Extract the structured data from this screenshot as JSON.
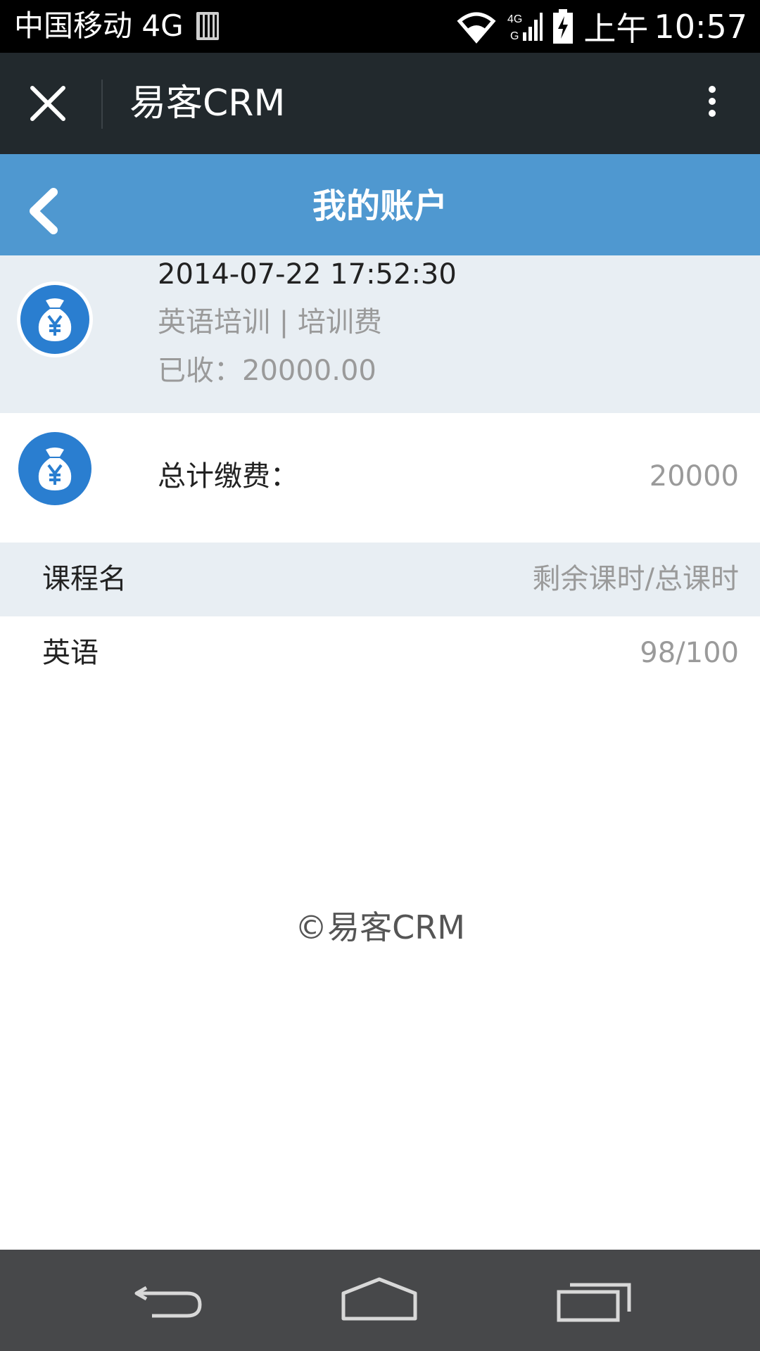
{
  "status_bar": {
    "carrier": "中国移动 4G",
    "time_prefix": "上午",
    "time": "10:57",
    "network": "4G"
  },
  "top_bar": {
    "title": "易客CRM"
  },
  "header": {
    "title": "我的账户"
  },
  "record": {
    "datetime": "2014-07-22 17:52:30",
    "category": "英语培训 | 培训费",
    "paid": "已收：20000.00"
  },
  "total": {
    "label": "总计缴费：",
    "value": "20000"
  },
  "courses": {
    "header_name": "课程名",
    "header_hours": "剩余课时/总课时",
    "rows": [
      {
        "name": "英语",
        "hours": "98/100"
      }
    ]
  },
  "footer": {
    "copyright": "©易客CRM"
  },
  "colors": {
    "header_blue": "#4f98d0",
    "icon_blue": "#2a7ed0",
    "top_bar": "#22292d",
    "row_bg": "#e8eef3"
  }
}
